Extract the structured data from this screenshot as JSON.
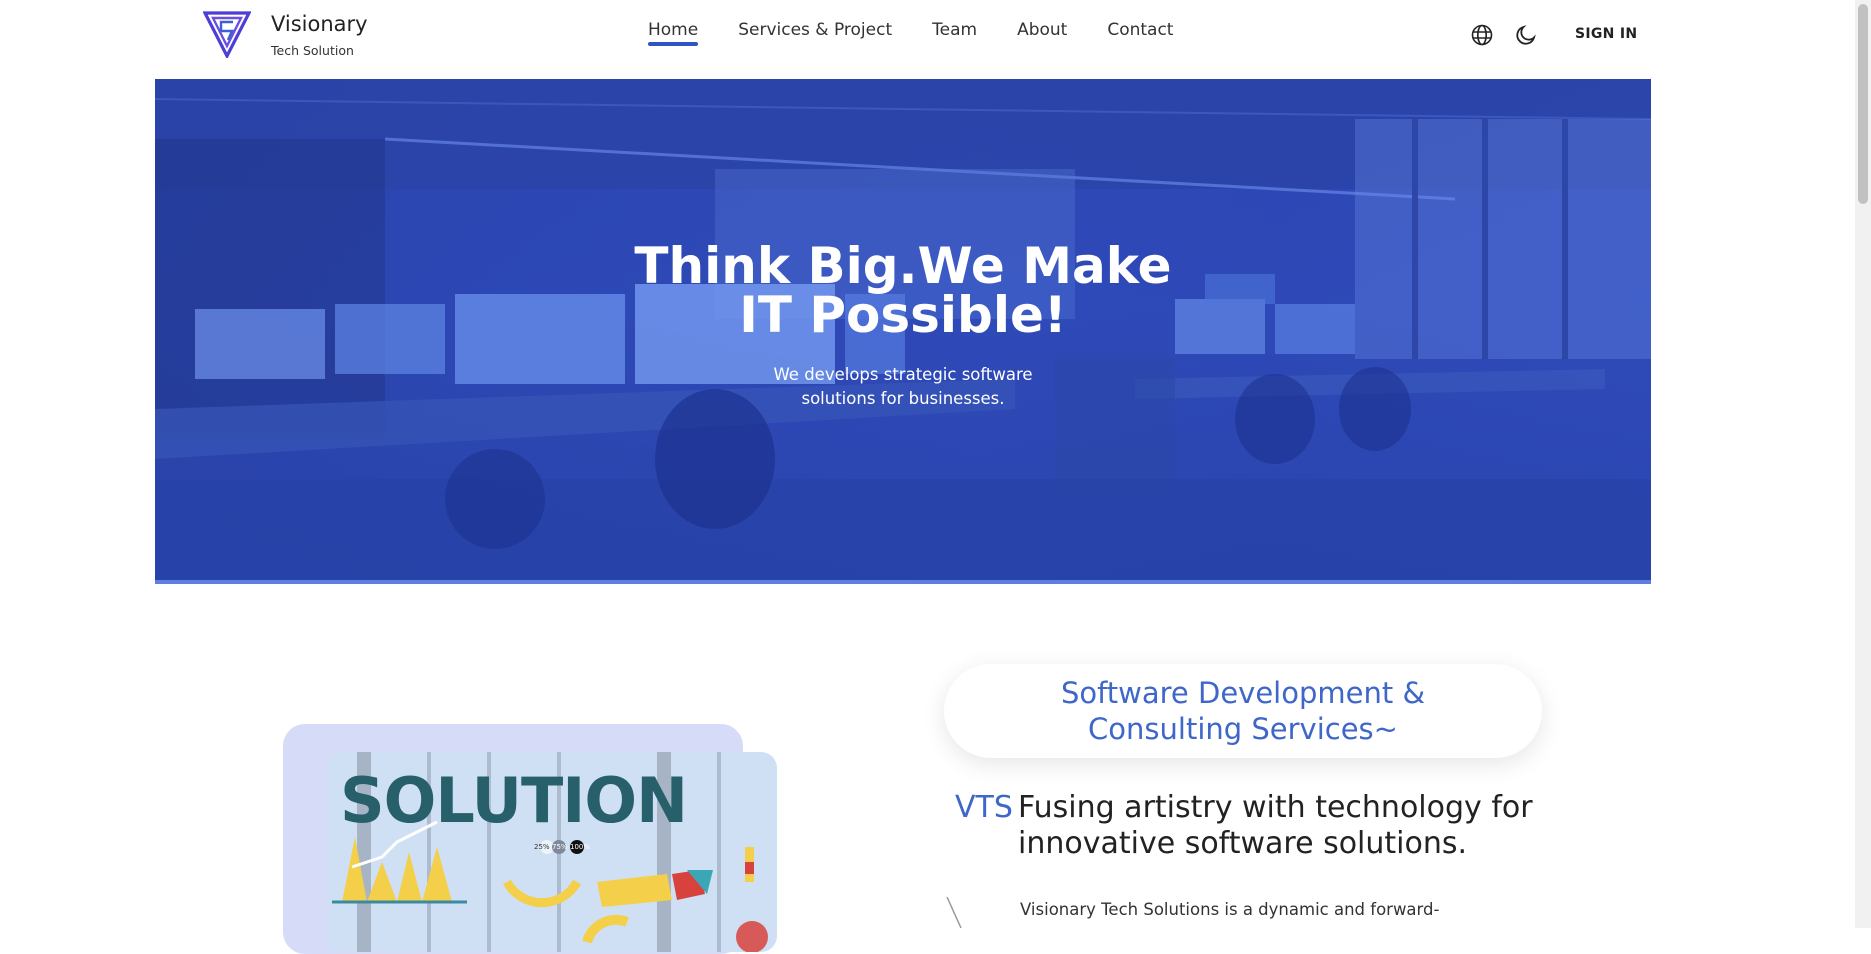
{
  "header": {
    "brand_name": "Visionary",
    "brand_sub": "Tech Solution",
    "nav": [
      {
        "label": "Home",
        "active": true
      },
      {
        "label": "Services & Project",
        "active": false
      },
      {
        "label": "Team",
        "active": false
      },
      {
        "label": "About",
        "active": false
      },
      {
        "label": "Contact",
        "active": false
      }
    ],
    "icons": [
      "globe-icon",
      "moon-icon"
    ],
    "signin_label": "SIGN IN"
  },
  "hero": {
    "title_line1": "Think Big.We Make",
    "title_line2": "IT Possible!",
    "subtitle_line1": "We develops strategic software",
    "subtitle_line2": "solutions for businesses."
  },
  "services": {
    "pill_line1": "Software Development &",
    "pill_line2": "Consulting Services~",
    "abbr": "VTS",
    "headline_line1": "Fusing artistry with technology for",
    "headline_line2": "innovative software solutions.",
    "description": "Visionary Tech Solutions is a dynamic and forward-",
    "image_title": "SOLUTION",
    "image_percents": [
      "25%",
      "75%",
      "100%"
    ]
  },
  "colors": {
    "accent": "#2f55c4",
    "hero_overlay": "#2e4ab8",
    "pill_text": "#3f66c9",
    "solution_text": "#27606a"
  }
}
